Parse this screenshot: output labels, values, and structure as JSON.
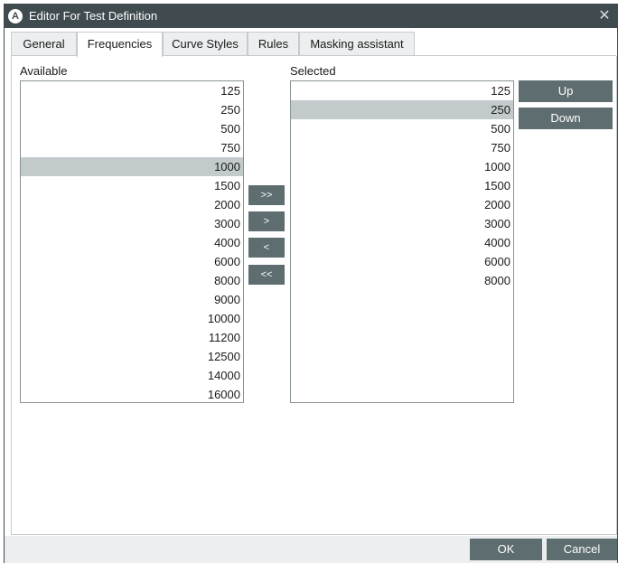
{
  "window": {
    "title": "Editor For Test Definition",
    "app_icon_glyph": "A",
    "close_glyph": "✕"
  },
  "tabs": [
    {
      "label": "General",
      "active": false
    },
    {
      "label": "Frequencies",
      "active": true
    },
    {
      "label": "Curve Styles",
      "active": false
    },
    {
      "label": "Rules",
      "active": false
    },
    {
      "label": "Masking assistant",
      "active": false
    }
  ],
  "available": {
    "label": "Available",
    "items": [
      "125",
      "250",
      "500",
      "750",
      "1000",
      "1500",
      "2000",
      "3000",
      "4000",
      "6000",
      "8000",
      "9000",
      "10000",
      "11200",
      "12500",
      "14000",
      "16000"
    ],
    "selected_item": "1000"
  },
  "selected": {
    "label": "Selected",
    "items": [
      "125",
      "250",
      "500",
      "750",
      "1000",
      "1500",
      "2000",
      "3000",
      "4000",
      "6000",
      "8000"
    ],
    "selected_item": "250"
  },
  "transfer_buttons": {
    "add_all": ">>",
    "add": ">",
    "remove": "<",
    "remove_all": "<<"
  },
  "order_buttons": {
    "up": "Up",
    "down": "Down"
  },
  "footer": {
    "ok": "OK",
    "cancel": "Cancel"
  },
  "colors": {
    "titlebar": "#3f4b4f",
    "button": "#5e6d70",
    "selection": "#c3cacc",
    "tab_inactive": "#eceeef"
  },
  "icons": {
    "app": "app-logo-icon",
    "close": "close-icon"
  }
}
